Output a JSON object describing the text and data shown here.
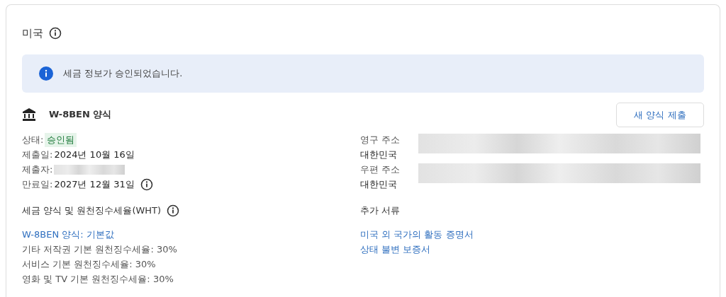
{
  "card": {
    "title": "미국",
    "banner": {
      "message": "세금 정보가 승인되었습니다."
    },
    "form": {
      "name": "W-8BEN 양식",
      "button": "새 양식 제출"
    },
    "details": [
      {
        "label": "상태:",
        "value": "승인됨",
        "kind": "status",
        "info": false,
        "redacted": false
      },
      {
        "label": "제출일:",
        "value": "2024년 10월 16일",
        "kind": "plain",
        "info": false,
        "redacted": false
      },
      {
        "label": "제출자:",
        "kind": "plain",
        "info": false,
        "redacted": true
      },
      {
        "label": "만료일:",
        "value": "2027년 12월 31일",
        "kind": "plain",
        "info": true,
        "redacted": false
      }
    ],
    "addresses": [
      {
        "label": "영구 주소",
        "country": "대한민국",
        "redacted": true
      },
      {
        "label": "우편 주소",
        "country": "대한민국",
        "redacted": true
      }
    ],
    "wht": {
      "heading": "세금 양식 및 원천징수세율(WHT)",
      "link": "W-8BEN 양식: 기본값",
      "rates": [
        "기타 저작권 기본 원천징수세율: 30%",
        "서비스 기본 원천징수세율: 30%",
        "영화 및 TV 기본 원천징수세율: 30%"
      ]
    },
    "documents": {
      "heading": "추가 서류",
      "links": [
        "미국 외 국가의 활동 증명서",
        "상태 불변 보증서"
      ]
    }
  }
}
